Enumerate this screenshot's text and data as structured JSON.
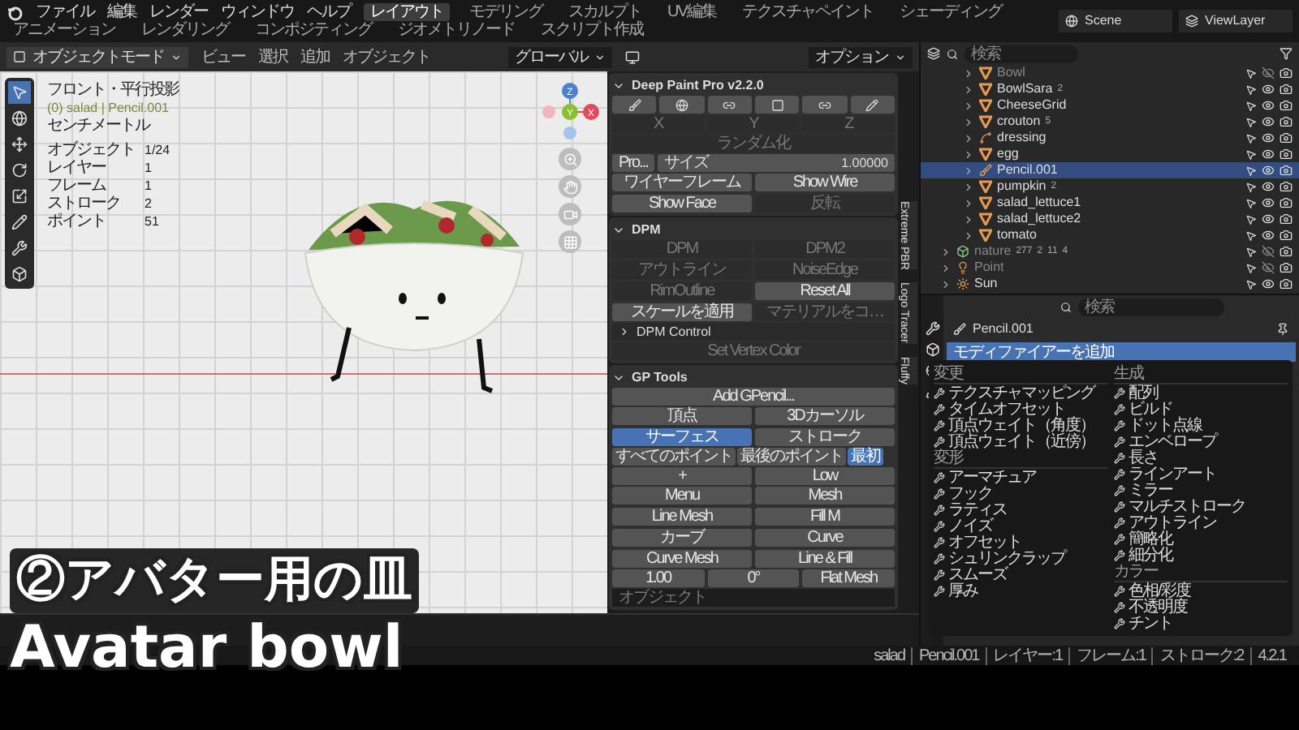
{
  "top_menu": [
    "ファイル",
    "編集",
    "レンダー",
    "ウィンドウ",
    "ヘルプ"
  ],
  "workspaces": [
    {
      "label": "レイアウト",
      "selected": true
    },
    {
      "label": "モデリング",
      "selected": false
    },
    {
      "label": "スカルプト",
      "selected": false
    },
    {
      "label": "UV編集",
      "selected": false
    },
    {
      "label": "テクスチャペイント",
      "selected": false
    },
    {
      "label": "シェーディング",
      "selected": false
    },
    {
      "label": "アニメーション",
      "selected": false
    },
    {
      "label": "レンダリング",
      "selected": false
    },
    {
      "label": "コンポジティング",
      "selected": false
    },
    {
      "label": "ジオメトリノード",
      "selected": false
    },
    {
      "label": "スクリプト作成",
      "selected": false
    }
  ],
  "scene": "Scene",
  "view_layer": "ViewLayer",
  "header": {
    "mode": "オブジェクトモード",
    "menus": [
      "ビュー",
      "選択",
      "追加",
      "オブジェクト"
    ],
    "orientation": "グローバル",
    "options": "オプション"
  },
  "viewport": {
    "view_name": "フロント・平行投影",
    "active": "(0) salad | Pencil.001",
    "units": "センチメートル",
    "stats": [
      {
        "label": "オブジェクト",
        "value": "1/24"
      },
      {
        "label": "レイヤー",
        "value": "1"
      },
      {
        "label": "フレーム",
        "value": "1"
      },
      {
        "label": "ストローク",
        "value": "2"
      },
      {
        "label": "ポイント",
        "value": "51"
      }
    ],
    "gizmo_axes": [
      "Z",
      "Y",
      "X"
    ]
  },
  "deep_paint": {
    "title": "Deep Paint Pro v2.2.0",
    "expanded": true,
    "axes": [
      "X",
      "Y",
      "Z"
    ],
    "randomize": "ランダム化",
    "pro": "Pro...",
    "size_label": "サイズ",
    "size_value": "1.00000",
    "wireframe": "ワイヤーフレーム",
    "show_wire": "Show Wire",
    "show_face": "Show Face",
    "flip": "反転"
  },
  "dpm": {
    "title": "DPM",
    "expanded": true,
    "buttons": [
      {
        "label": "DPM",
        "disabled": true
      },
      {
        "label": "DPM2",
        "disabled": true
      },
      {
        "label": "アウトライン",
        "disabled": true
      },
      {
        "label": "NoiseEdge",
        "disabled": true
      },
      {
        "label": "RimOutline",
        "disabled": true
      },
      {
        "label": "Reset All",
        "disabled": false
      },
      {
        "label": "スケールを適用",
        "disabled": false
      },
      {
        "label": "マテリアルをコ…",
        "disabled": true
      }
    ],
    "control": {
      "label": "DPM Control",
      "expanded": false
    },
    "vertex_color": "Set Vertex Color"
  },
  "gp_tools": {
    "title": "GP Tools",
    "expanded": true,
    "add": "Add GPencil...",
    "placement": [
      {
        "label": "頂点",
        "selected": false
      },
      {
        "label": "3Dカーソル",
        "selected": false
      },
      {
        "label": "サーフェス",
        "selected": true
      },
      {
        "label": "ストローク",
        "selected": false
      }
    ],
    "points": [
      {
        "label": "すべてのポイント",
        "selected": false
      },
      {
        "label": "最後のポイント",
        "selected": false
      },
      {
        "label": "最初",
        "selected": true
      }
    ],
    "quality": [
      "+",
      "Low"
    ],
    "tools": [
      "Menu",
      "Mesh",
      "Line Mesh",
      "Fill M",
      "カーブ",
      "Curve",
      "Curve Mesh",
      "Line & Fill"
    ],
    "thickness": "1.00",
    "angle": "0°",
    "flat_mesh": "Flat Mesh",
    "object_placeholder": "オブジェクト"
  },
  "sidebar_tabs": [
    "Extreme PBR",
    "Logo Tracer",
    "Fluffy"
  ],
  "outliner": {
    "search_placeholder": "検索",
    "collection_items": [
      {
        "name": "Bowl",
        "kind": "mesh",
        "visible": false,
        "selected": false
      },
      {
        "name": "BowlSara",
        "kind": "mesh",
        "visible": true,
        "selected": false,
        "counts": [
          "2"
        ]
      },
      {
        "name": "CheeseGrid",
        "kind": "mesh",
        "visible": true,
        "selected": false
      },
      {
        "name": "crouton",
        "kind": "mesh",
        "visible": true,
        "selected": false,
        "counts": [
          "5"
        ]
      },
      {
        "name": "dressing",
        "kind": "curve",
        "visible": true,
        "selected": false
      },
      {
        "name": "egg",
        "kind": "mesh",
        "visible": true,
        "selected": false
      },
      {
        "name": "Pencil.001",
        "kind": "gpencil",
        "visible": true,
        "selected": true
      },
      {
        "name": "pumpkin",
        "kind": "mesh",
        "visible": true,
        "selected": false,
        "counts": [
          "2"
        ]
      },
      {
        "name": "salad_lettuce1",
        "kind": "mesh",
        "visible": true,
        "selected": false
      },
      {
        "name": "salad_lettuce2",
        "kind": "mesh",
        "visible": true,
        "selected": false
      },
      {
        "name": "tomato",
        "kind": "mesh",
        "visible": true,
        "selected": false
      }
    ],
    "scene_items": [
      {
        "name": "nature",
        "kind": "collection",
        "visible": false,
        "selected": false,
        "counts": [
          "277",
          "2",
          "11",
          "4"
        ]
      },
      {
        "name": "Point",
        "kind": "light",
        "visible": false,
        "selected": false
      },
      {
        "name": "Sun",
        "kind": "sun",
        "visible": true,
        "selected": false
      }
    ]
  },
  "properties": {
    "search_placeholder": "検索",
    "object_name": "Pencil.001",
    "add_modifier": "モディファイアーを追加"
  },
  "modifier_menu": [
    {
      "title": "変更",
      "items": [
        "テクスチャマッピング",
        "タイムオフセット",
        "頂点ウェイト（角度）",
        "頂点ウェイト（近傍）"
      ]
    },
    {
      "title": "生成",
      "items": [
        "配列",
        "ビルド",
        "ドット点線",
        "エンベロープ",
        "長さ",
        "ラインアート",
        "ミラー",
        "マルチストローク",
        "アウトライン",
        "簡略化",
        "細分化"
      ]
    },
    {
      "title": "変形",
      "items": [
        "アーマチュア",
        "フック",
        "ラティス",
        "ノイズ",
        "オフセット",
        "シュリンクラップ",
        "スムーズ",
        "厚み"
      ]
    },
    {
      "title": "カラー",
      "items": [
        "色相/彩度",
        "不透明度",
        "チント"
      ]
    }
  ],
  "status_bar": [
    "salad",
    "Pencil.001",
    "レイヤー:1",
    "フレーム:1",
    "ストローク:2",
    "4.2.1"
  ],
  "caption": {
    "title": "②アバター用の皿",
    "subtitle": "Avatar bowl"
  }
}
